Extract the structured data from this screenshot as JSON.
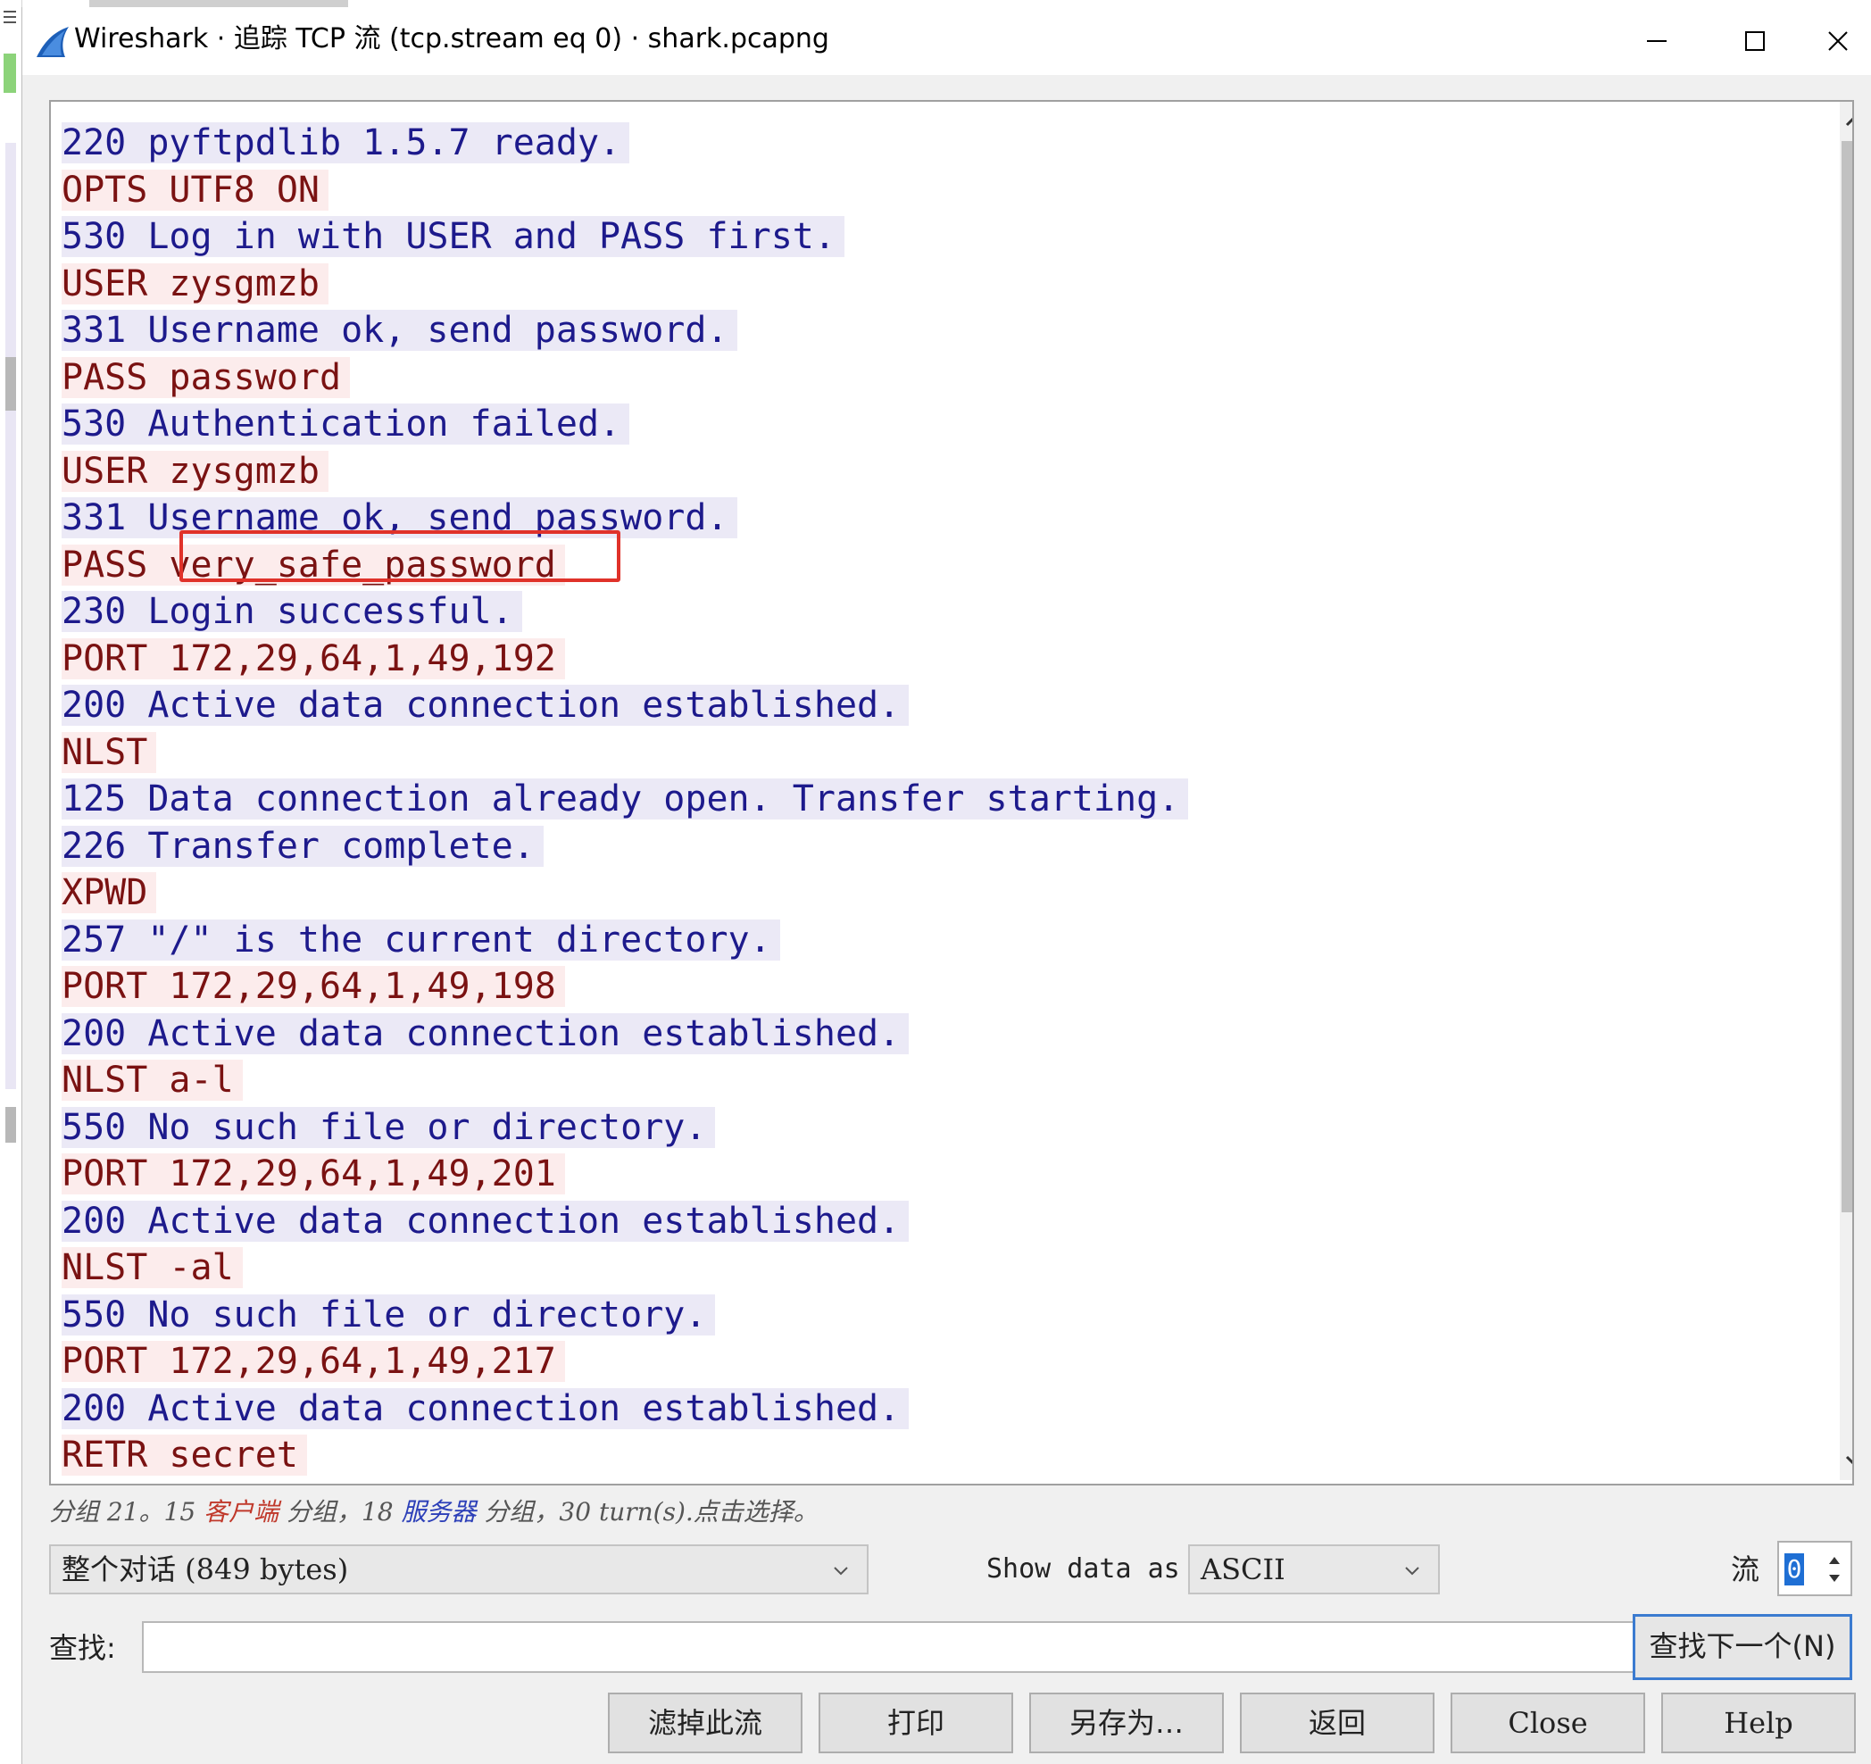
{
  "window": {
    "title": "Wireshark · 追踪 TCP 流 (tcp.stream eq 0) · shark.pcapng"
  },
  "stream": {
    "lines": [
      {
        "side": "server",
        "text": "220 pyftpdlib 1.5.7 ready."
      },
      {
        "side": "client",
        "text": "OPTS UTF8 ON"
      },
      {
        "side": "server",
        "text": "530 Log in with USER and PASS first."
      },
      {
        "side": "client",
        "text": "USER zysgmzb"
      },
      {
        "side": "server",
        "text": "331 Username ok, send password."
      },
      {
        "side": "client",
        "text": "PASS password"
      },
      {
        "side": "server",
        "text": "530 Authentication failed."
      },
      {
        "side": "client",
        "text": "USER zysgmzb"
      },
      {
        "side": "server",
        "text": "331 Username ok, send password."
      },
      {
        "side": "client",
        "text": "PASS very_safe_password"
      },
      {
        "side": "server",
        "text": "230 Login successful."
      },
      {
        "side": "client",
        "text": "PORT 172,29,64,1,49,192"
      },
      {
        "side": "server",
        "text": "200 Active data connection established."
      },
      {
        "side": "client",
        "text": "NLST"
      },
      {
        "side": "server",
        "text": "125 Data connection already open. Transfer starting."
      },
      {
        "side": "server",
        "text": "226 Transfer complete."
      },
      {
        "side": "client",
        "text": "XPWD"
      },
      {
        "side": "server",
        "text": "257 \"/\" is the current directory."
      },
      {
        "side": "client",
        "text": "PORT 172,29,64,1,49,198"
      },
      {
        "side": "server",
        "text": "200 Active data connection established."
      },
      {
        "side": "client",
        "text": "NLST a-l"
      },
      {
        "side": "server",
        "text": "550 No such file or directory."
      },
      {
        "side": "client",
        "text": "PORT 172,29,64,1,49,201"
      },
      {
        "side": "server",
        "text": "200 Active data connection established."
      },
      {
        "side": "client",
        "text": "NLST -al"
      },
      {
        "side": "server",
        "text": "550 No such file or directory."
      },
      {
        "side": "client",
        "text": "PORT 172,29,64,1,49,217"
      },
      {
        "side": "server",
        "text": "200 Active data connection established."
      },
      {
        "side": "client",
        "text": "RETR secret"
      }
    ],
    "highlight_text": "very_safe_password"
  },
  "summary": {
    "part1": "分组 21。15 ",
    "client_word": "客户端",
    "part2": " 分组，18 ",
    "server_word": "服务器",
    "part3": " 分组，30 turn(s).点击选择。"
  },
  "controls": {
    "conversation_select": "整个对话 (849 bytes)",
    "show_data_label": "Show data as",
    "format_select": "ASCII",
    "stream_label": "流",
    "stream_value": "0",
    "find_label": "查找:",
    "find_value": "",
    "find_next": "查找下一个(N)"
  },
  "buttons": {
    "filter_out": "滤掉此流",
    "print": "打印",
    "save_as": "另存为…",
    "back": "返回",
    "close": "Close",
    "help": "Help"
  },
  "colors": {
    "server_text": "#1d1a8c",
    "server_bg": "#ebe9f6",
    "client_text": "#7a1212",
    "client_bg": "#fcecec",
    "highlight_border": "#e0322a"
  }
}
